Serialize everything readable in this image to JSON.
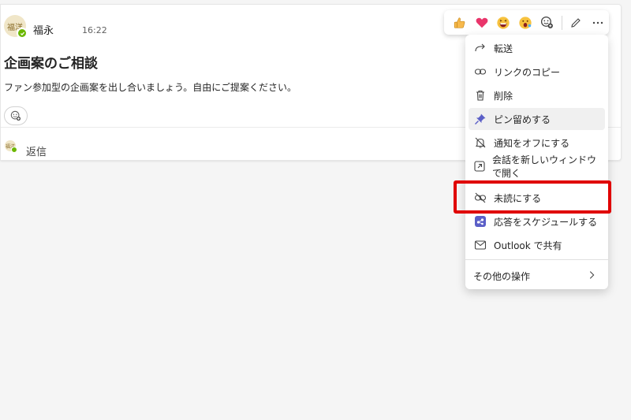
{
  "message": {
    "avatar_initials": "福洋",
    "author": "福永",
    "time": "16:22",
    "subject": "企画案のご相談",
    "body": "ファン参加型の企画案を出し合いましょう。自由にご提案ください。",
    "reply_label": "返信"
  },
  "reactions": [
    "like-emoji",
    "heart-emoji",
    "laugh-emoji",
    "surprised-emoji",
    "add-reaction-icon",
    "edit-icon",
    "more-icon"
  ],
  "menu": {
    "items": [
      {
        "label": "転送",
        "icon": "forward-icon"
      },
      {
        "label": "リンクのコピー",
        "icon": "link-icon"
      },
      {
        "label": "削除",
        "icon": "trash-icon"
      },
      {
        "label": "ピン留めする",
        "icon": "pin-icon"
      },
      {
        "label": "通知をオフにする",
        "icon": "bell-off-icon"
      },
      {
        "label": "会話を新しいウィンドウで開く",
        "icon": "popout-icon"
      },
      {
        "label": "未読にする",
        "icon": "unread-icon"
      },
      {
        "label": "応答をスケジュールする",
        "icon": "schedule-app-icon"
      },
      {
        "label": "Outlook で共有",
        "icon": "mail-icon"
      },
      {
        "label": "その他の操作",
        "icon": "chevron-right-icon"
      }
    ]
  },
  "colors": {
    "highlight": "#e00000",
    "presence": "#6bb700",
    "pin": "#5b5fc7"
  }
}
